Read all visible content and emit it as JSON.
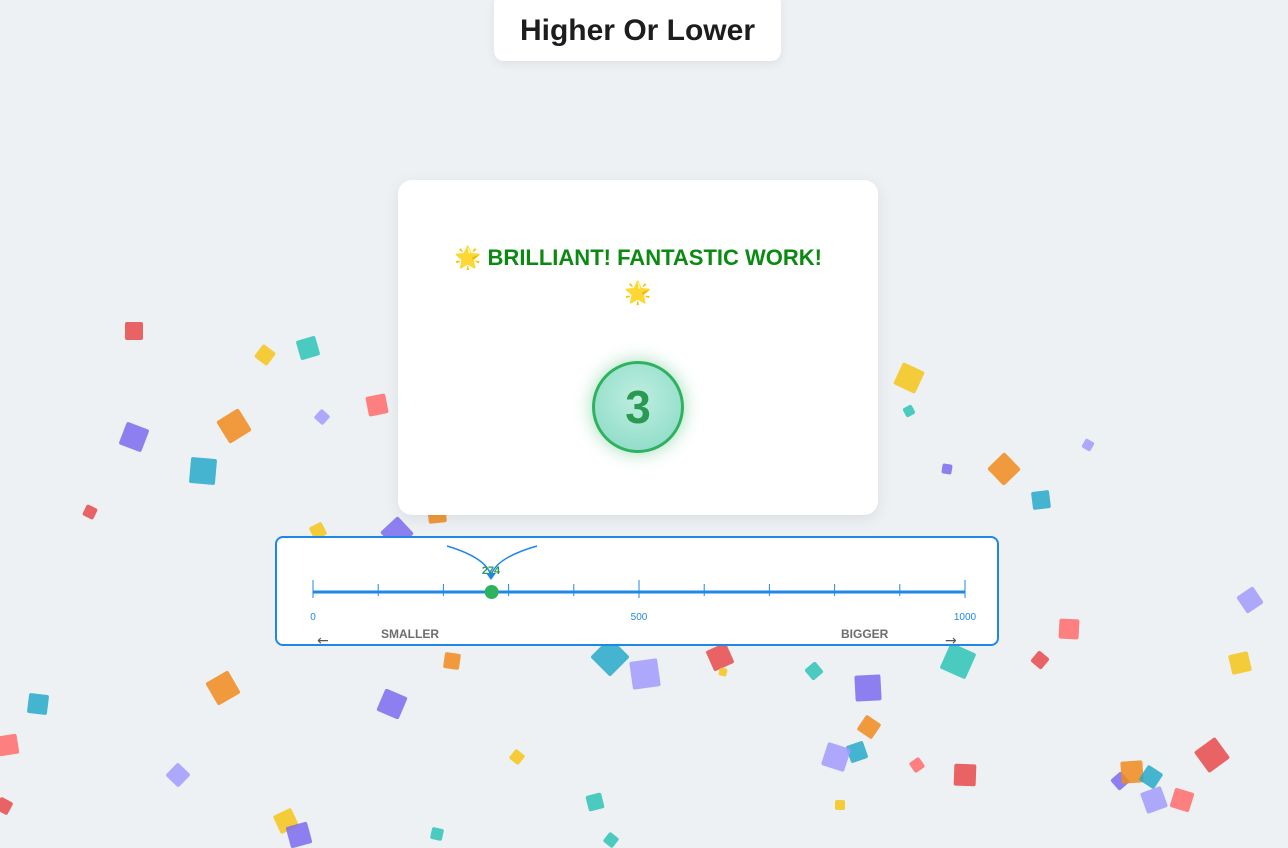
{
  "header": {
    "title": "Higher Or Lower"
  },
  "result": {
    "message": "BRILLIANT! FANTASTIC WORK!",
    "spark_glyph": "🌟",
    "count": "3"
  },
  "number_line": {
    "min": 0,
    "max": 1000,
    "tick_labels": [
      "0",
      "500",
      "1000"
    ],
    "guess_value": "274",
    "smaller_label": "SMALLER",
    "bigger_label": "BIGGER",
    "left_arrow_icon": "arrow-left-icon",
    "right_arrow_icon": "arrow-right-icon",
    "accent_color": "#1f88e5",
    "marker_color": "#2fb25f"
  },
  "theme": {
    "message_color": "#0b8a12",
    "confetti_colors": [
      "#e84a4a",
      "#f5c518",
      "#2ec4b6",
      "#7c6bf0",
      "#f08a1c",
      "#26a9c9",
      "#a29bfe",
      "#ff6b6b"
    ]
  }
}
